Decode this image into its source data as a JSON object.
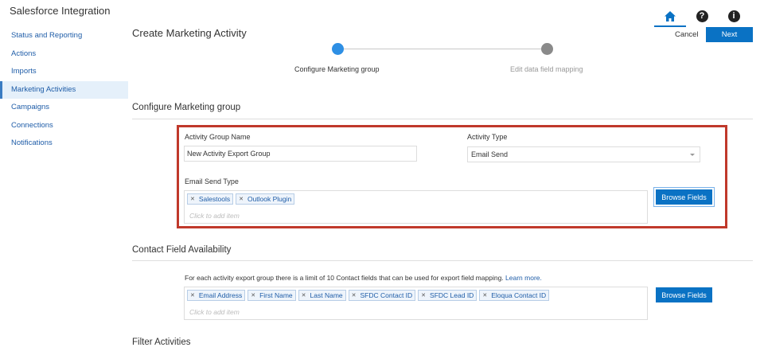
{
  "app": {
    "title": "Salesforce Integration"
  },
  "sidebar": {
    "items": [
      {
        "label": "Status and Reporting"
      },
      {
        "label": "Actions"
      },
      {
        "label": "Imports"
      },
      {
        "label": "Marketing Activities"
      },
      {
        "label": "Campaigns"
      },
      {
        "label": "Connections"
      },
      {
        "label": "Notifications"
      }
    ],
    "active_item": "Marketing Activities"
  },
  "header": {
    "icons": [
      "home-icon",
      "help-icon",
      "info-icon"
    ],
    "help_glyph": "?",
    "info_glyph": "i",
    "page_title": "Create Marketing Activity",
    "cancel_label": "Cancel",
    "next_label": "Next"
  },
  "wizard": {
    "steps": [
      {
        "label": "Configure Marketing group",
        "state": "current"
      },
      {
        "label": "Edit data field mapping",
        "state": "upcoming"
      }
    ]
  },
  "configure_section": {
    "title": "Configure Marketing group",
    "activity_group_name": {
      "label": "Activity Group Name",
      "value": "New Activity Export Group"
    },
    "activity_type": {
      "label": "Activity Type",
      "value": "Email Send"
    },
    "email_send_type": {
      "label": "Email Send Type",
      "tags": [
        "Salestools",
        "Outlook Plugin"
      ],
      "placeholder": "Click to add item",
      "browse_label": "Browse Fields"
    }
  },
  "contact_section": {
    "title": "Contact Field Availability",
    "info_text": "For each activity export group there is a limit of 10 Contact fields that can be used for export field mapping.",
    "learn_more": "Learn more.",
    "tags": [
      "Email Address",
      "First Name",
      "Last Name",
      "SFDC Contact ID",
      "SFDC Lead ID",
      "Eloqua Contact ID"
    ],
    "placeholder": "Click to add item",
    "browse_label": "Browse Fields"
  },
  "filter_section": {
    "title": "Filter Activities"
  },
  "colors": {
    "primary": "#0a72c4",
    "link": "#1f5da8",
    "highlight_border": "#c0392b",
    "step_active": "#2e8fe4",
    "step_inactive": "#8a8a8a"
  }
}
